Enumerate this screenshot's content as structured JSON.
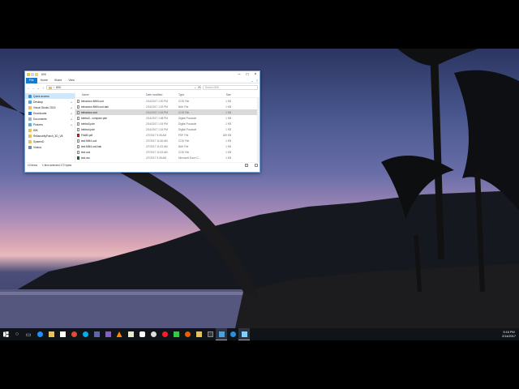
{
  "window": {
    "title": "80K",
    "tabs": [
      "File",
      "Home",
      "Share",
      "View"
    ],
    "address_path": "80K",
    "search_placeholder": "Search 80K"
  },
  "nav_pane": {
    "items": [
      {
        "label": "Quick access",
        "icon": "star-icon",
        "pinned": false
      },
      {
        "label": "Desktop",
        "icon": "desktop-icon",
        "pinned": true
      },
      {
        "label": "Visual Studio 2015",
        "icon": "folder-icon",
        "pinned": true
      },
      {
        "label": "Downloads",
        "icon": "download-icon",
        "pinned": true
      },
      {
        "label": "Documents",
        "icon": "documents-icon",
        "pinned": true
      },
      {
        "label": "Pictures",
        "icon": "pictures-icon",
        "pinned": true
      },
      {
        "label": "80K",
        "icon": "folder-icon",
        "pinned": false
      },
      {
        "label": "RelianceityPatch_3D_V8",
        "icon": "folder-icon",
        "pinned": false
      },
      {
        "label": "SystemD",
        "icon": "folder-icon",
        "pinned": false
      },
      {
        "label": "Videos",
        "icon": "videos-icon",
        "pinned": false
      }
    ]
  },
  "file_list": {
    "columns": [
      "Name",
      "Date modified",
      "Type",
      "Size"
    ],
    "rows": [
      {
        "name": "behaviour.MM4.cod",
        "date": "2/14/2017 1:20 PM",
        "type": "COD File",
        "size": "1 KB",
        "icon": "file-icon"
      },
      {
        "name": "behaviour.MM4.cod.bak",
        "date": "2/14/2017 1:02 PM",
        "type": "BAK File",
        "size": "1 KB",
        "icon": "file-icon"
      },
      {
        "name": "behaviour.cod",
        "date": "2/14/2017 1:15 PM",
        "type": "COD File",
        "size": "1 KB",
        "icon": "file-icon"
      },
      {
        "name": "bebba3 - compare.pde",
        "date": "2/14/2017 1:08 PM",
        "type": "Digital Pocasde",
        "size": "1 KB",
        "icon": "file-icon"
      },
      {
        "name": "bebba3.pde",
        "date": "2/14/2017 1:15 PM",
        "type": "Digital Pocasde",
        "size": "1 KB",
        "icon": "file-icon"
      },
      {
        "name": "bebba4.pde",
        "date": "2/14/2017 1:15 PM",
        "type": "Digital Pocasde",
        "size": "1 KB",
        "icon": "file-icon"
      },
      {
        "name": "Fbk80.pdf",
        "date": "2/7/2017 9:28 AM",
        "type": "PDF File",
        "size": "189 KB",
        "icon": "pdf-icon"
      },
      {
        "name": "test.MM4.cod",
        "date": "2/7/2017 11:06 AM",
        "type": "COD File",
        "size": "1 KB",
        "icon": "file-icon"
      },
      {
        "name": "test.MM4.cod.bak",
        "date": "2/7/2017 11:03 AM",
        "type": "BAK File",
        "size": "1 KB",
        "icon": "file-icon"
      },
      {
        "name": "test.cod",
        "date": "2/7/2017 11:03 AM",
        "type": "COD File",
        "size": "1 KB",
        "icon": "file-icon"
      },
      {
        "name": "test.csv",
        "date": "2/7/2017 9:28 AM",
        "type": "Microsoft Excel C...",
        "size": "1 KB",
        "icon": "csv-icon"
      }
    ],
    "selected_index": 2
  },
  "status_bar": {
    "item_count": "10 items",
    "selection": "1 item selected 172 bytes"
  },
  "clock": {
    "time": "5:16 PM",
    "date": "2/14/2017"
  },
  "taskbar_icons": [
    {
      "name": "start-icon",
      "color": "#ffffff"
    },
    {
      "name": "search-icon",
      "color": "#ffffff"
    },
    {
      "name": "task-view-icon",
      "color": "#ffffff"
    },
    {
      "name": "edge-icon",
      "color": "#1e90ff"
    },
    {
      "name": "file-explorer-icon",
      "color": "#e8c15a"
    },
    {
      "name": "store-icon",
      "color": "#ffffff"
    },
    {
      "name": "chrome-icon",
      "color": "#e04b3c"
    },
    {
      "name": "skype-icon",
      "color": "#00aff0"
    },
    {
      "name": "teams-icon",
      "color": "#6264a7"
    },
    {
      "name": "visual-studio-icon",
      "color": "#865fc5"
    },
    {
      "name": "vlc-icon",
      "color": "#ff8800"
    },
    {
      "name": "word-icon",
      "color": "#e8e8d0"
    },
    {
      "name": "paint-icon",
      "color": "#ffffff"
    },
    {
      "name": "alarm-icon",
      "color": "#dddddd"
    },
    {
      "name": "opera-icon",
      "color": "#ff1b2d"
    },
    {
      "name": "green-app-icon",
      "color": "#2ecc40"
    },
    {
      "name": "firefox-icon",
      "color": "#e66000"
    },
    {
      "name": "folder-app-icon",
      "color": "#e8c15a"
    },
    {
      "name": "dark-app-icon",
      "color": "#3a3a3a"
    },
    {
      "name": "media-app-icon",
      "color": "#4aa3df"
    },
    {
      "name": "blue-app-icon",
      "color": "#2b8fe0"
    },
    {
      "name": "explorer-window-icon",
      "color": "#7fd2ff"
    }
  ]
}
